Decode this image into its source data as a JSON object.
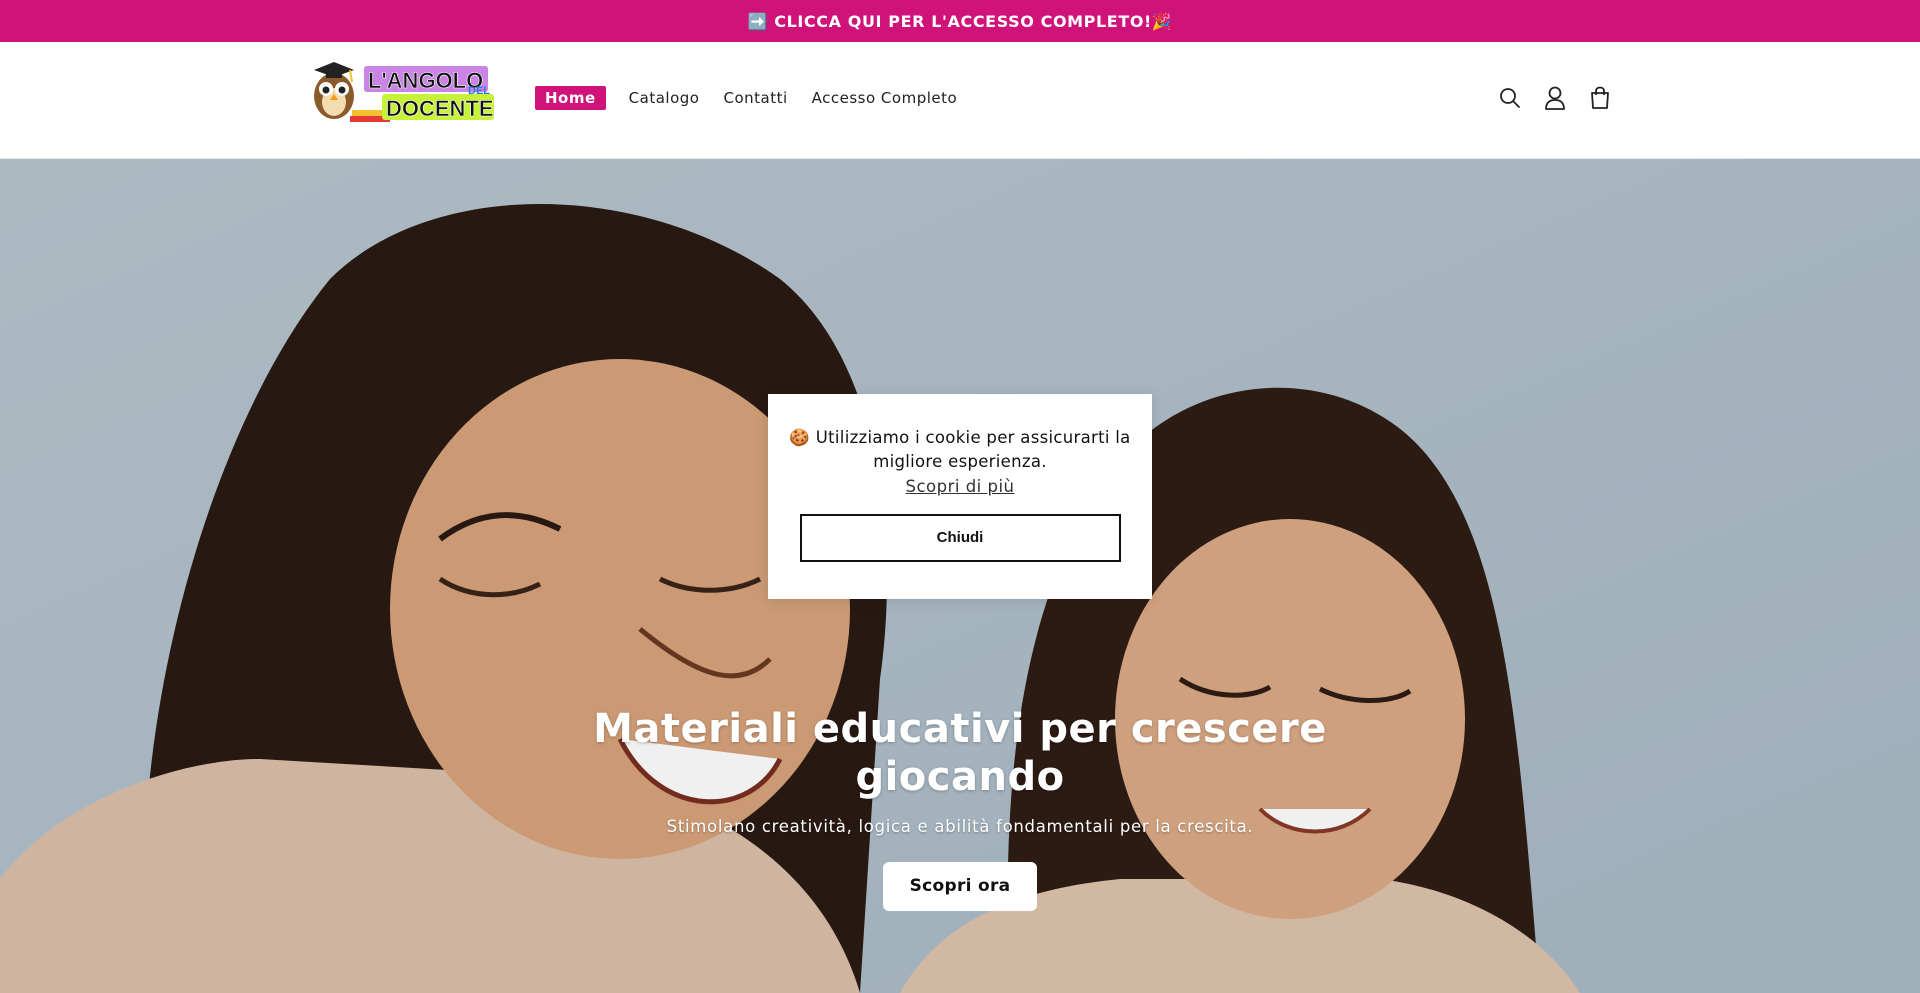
{
  "announcement": {
    "text": "➡️ CLICCA QUI PER L'ACCESSO COMPLETO!🎉"
  },
  "header": {
    "logo_text_top": "L'ANGOLO",
    "logo_text_mid": "DEL",
    "logo_text_bottom": "DOCENTE",
    "nav": [
      {
        "label": "Home",
        "active": true
      },
      {
        "label": "Catalogo"
      },
      {
        "label": "Contatti"
      },
      {
        "label": "Accesso Completo"
      }
    ],
    "icons": [
      "search-icon",
      "account-icon",
      "cart-icon"
    ]
  },
  "hero": {
    "title": "Materiali educativi per crescere giocando",
    "subtitle": "Stimolano creatività, logica e abilità fondamentali per la crescita.",
    "button": "Scopri ora"
  },
  "cookie": {
    "message": "🍪 Utilizziamo i cookie per assicurarti la migliore esperienza.",
    "link": "Scopri di più",
    "button": "Chiudi"
  },
  "colors": {
    "brand": "#cf1379",
    "hero_bg": "#b9c8d1",
    "skin": "#d8a47c",
    "hair": "#2a1a14",
    "sweater": "#dcc1a9"
  }
}
